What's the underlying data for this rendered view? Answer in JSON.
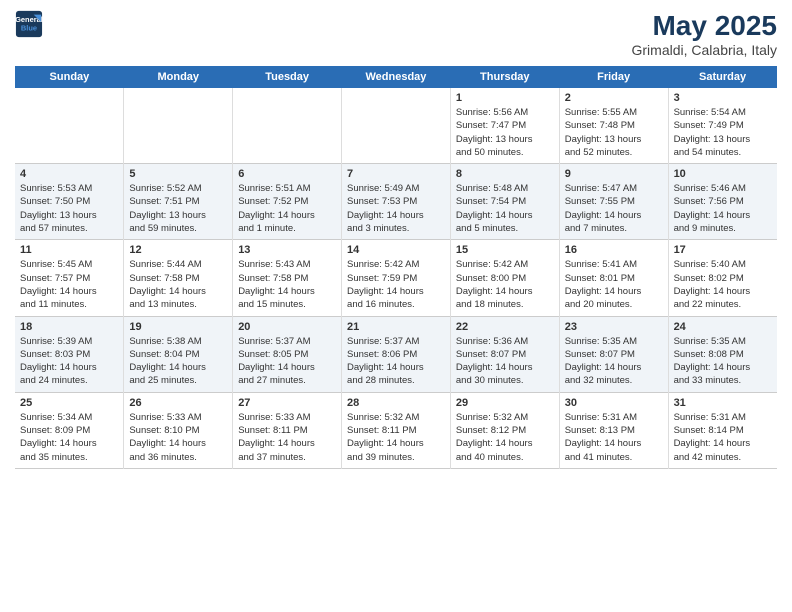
{
  "logo": {
    "line1": "General",
    "line2": "Blue"
  },
  "title": "May 2025",
  "subtitle": "Grimaldi, Calabria, Italy",
  "days_of_week": [
    "Sunday",
    "Monday",
    "Tuesday",
    "Wednesday",
    "Thursday",
    "Friday",
    "Saturday"
  ],
  "weeks": [
    [
      {
        "day": "",
        "info": ""
      },
      {
        "day": "",
        "info": ""
      },
      {
        "day": "",
        "info": ""
      },
      {
        "day": "",
        "info": ""
      },
      {
        "day": "1",
        "info": "Sunrise: 5:56 AM\nSunset: 7:47 PM\nDaylight: 13 hours\nand 50 minutes."
      },
      {
        "day": "2",
        "info": "Sunrise: 5:55 AM\nSunset: 7:48 PM\nDaylight: 13 hours\nand 52 minutes."
      },
      {
        "day": "3",
        "info": "Sunrise: 5:54 AM\nSunset: 7:49 PM\nDaylight: 13 hours\nand 54 minutes."
      }
    ],
    [
      {
        "day": "4",
        "info": "Sunrise: 5:53 AM\nSunset: 7:50 PM\nDaylight: 13 hours\nand 57 minutes."
      },
      {
        "day": "5",
        "info": "Sunrise: 5:52 AM\nSunset: 7:51 PM\nDaylight: 13 hours\nand 59 minutes."
      },
      {
        "day": "6",
        "info": "Sunrise: 5:51 AM\nSunset: 7:52 PM\nDaylight: 14 hours\nand 1 minute."
      },
      {
        "day": "7",
        "info": "Sunrise: 5:49 AM\nSunset: 7:53 PM\nDaylight: 14 hours\nand 3 minutes."
      },
      {
        "day": "8",
        "info": "Sunrise: 5:48 AM\nSunset: 7:54 PM\nDaylight: 14 hours\nand 5 minutes."
      },
      {
        "day": "9",
        "info": "Sunrise: 5:47 AM\nSunset: 7:55 PM\nDaylight: 14 hours\nand 7 minutes."
      },
      {
        "day": "10",
        "info": "Sunrise: 5:46 AM\nSunset: 7:56 PM\nDaylight: 14 hours\nand 9 minutes."
      }
    ],
    [
      {
        "day": "11",
        "info": "Sunrise: 5:45 AM\nSunset: 7:57 PM\nDaylight: 14 hours\nand 11 minutes."
      },
      {
        "day": "12",
        "info": "Sunrise: 5:44 AM\nSunset: 7:58 PM\nDaylight: 14 hours\nand 13 minutes."
      },
      {
        "day": "13",
        "info": "Sunrise: 5:43 AM\nSunset: 7:58 PM\nDaylight: 14 hours\nand 15 minutes."
      },
      {
        "day": "14",
        "info": "Sunrise: 5:42 AM\nSunset: 7:59 PM\nDaylight: 14 hours\nand 16 minutes."
      },
      {
        "day": "15",
        "info": "Sunrise: 5:42 AM\nSunset: 8:00 PM\nDaylight: 14 hours\nand 18 minutes."
      },
      {
        "day": "16",
        "info": "Sunrise: 5:41 AM\nSunset: 8:01 PM\nDaylight: 14 hours\nand 20 minutes."
      },
      {
        "day": "17",
        "info": "Sunrise: 5:40 AM\nSunset: 8:02 PM\nDaylight: 14 hours\nand 22 minutes."
      }
    ],
    [
      {
        "day": "18",
        "info": "Sunrise: 5:39 AM\nSunset: 8:03 PM\nDaylight: 14 hours\nand 24 minutes."
      },
      {
        "day": "19",
        "info": "Sunrise: 5:38 AM\nSunset: 8:04 PM\nDaylight: 14 hours\nand 25 minutes."
      },
      {
        "day": "20",
        "info": "Sunrise: 5:37 AM\nSunset: 8:05 PM\nDaylight: 14 hours\nand 27 minutes."
      },
      {
        "day": "21",
        "info": "Sunrise: 5:37 AM\nSunset: 8:06 PM\nDaylight: 14 hours\nand 28 minutes."
      },
      {
        "day": "22",
        "info": "Sunrise: 5:36 AM\nSunset: 8:07 PM\nDaylight: 14 hours\nand 30 minutes."
      },
      {
        "day": "23",
        "info": "Sunrise: 5:35 AM\nSunset: 8:07 PM\nDaylight: 14 hours\nand 32 minutes."
      },
      {
        "day": "24",
        "info": "Sunrise: 5:35 AM\nSunset: 8:08 PM\nDaylight: 14 hours\nand 33 minutes."
      }
    ],
    [
      {
        "day": "25",
        "info": "Sunrise: 5:34 AM\nSunset: 8:09 PM\nDaylight: 14 hours\nand 35 minutes."
      },
      {
        "day": "26",
        "info": "Sunrise: 5:33 AM\nSunset: 8:10 PM\nDaylight: 14 hours\nand 36 minutes."
      },
      {
        "day": "27",
        "info": "Sunrise: 5:33 AM\nSunset: 8:11 PM\nDaylight: 14 hours\nand 37 minutes."
      },
      {
        "day": "28",
        "info": "Sunrise: 5:32 AM\nSunset: 8:11 PM\nDaylight: 14 hours\nand 39 minutes."
      },
      {
        "day": "29",
        "info": "Sunrise: 5:32 AM\nSunset: 8:12 PM\nDaylight: 14 hours\nand 40 minutes."
      },
      {
        "day": "30",
        "info": "Sunrise: 5:31 AM\nSunset: 8:13 PM\nDaylight: 14 hours\nand 41 minutes."
      },
      {
        "day": "31",
        "info": "Sunrise: 5:31 AM\nSunset: 8:14 PM\nDaylight: 14 hours\nand 42 minutes."
      }
    ]
  ]
}
